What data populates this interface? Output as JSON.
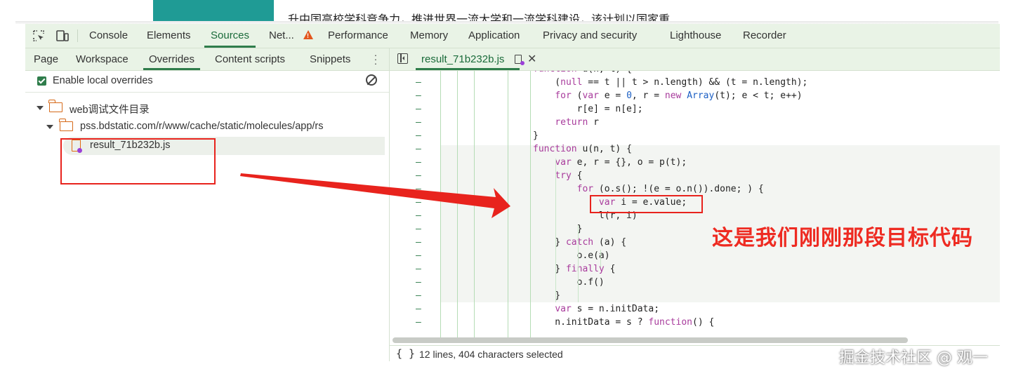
{
  "background_page": {
    "headline": "升中国高校学科竞争力，推进世界一流大学和一流学科建设，该计划以国家重"
  },
  "devtools": {
    "main_tabs": [
      {
        "label": "Console"
      },
      {
        "label": "Elements"
      },
      {
        "label": "Sources",
        "active": true
      },
      {
        "label": "Net..."
      },
      {
        "label": "Performance"
      },
      {
        "label": "Memory"
      },
      {
        "label": "Application"
      },
      {
        "label": "Privacy and security"
      },
      {
        "label": "Lighthouse"
      },
      {
        "label": "Recorder"
      }
    ],
    "left_panel": {
      "sub_tabs": [
        {
          "label": "Page"
        },
        {
          "label": "Workspace"
        },
        {
          "label": "Overrides",
          "active": true
        },
        {
          "label": "Content scripts"
        },
        {
          "label": "Snippets"
        }
      ],
      "enable_overrides_label": "Enable local overrides",
      "enable_overrides_checked": true,
      "tree": {
        "root_folder": "web调试文件目录",
        "sub_folder": "pss.bdstatic.com/r/www/cache/static/molecules/app/rs",
        "file": "result_71b232b.js"
      }
    },
    "editor": {
      "file_tab": "result_71b232b.js",
      "gutter_mark": "–",
      "lines": [
        {
          "text": "function u(n, t) {"
        },
        {
          "text": "    (null == t || t > n.length) && (t = n.length);"
        },
        {
          "text": "    for (var e = 0, r = new Array(t); e < t; e++)"
        },
        {
          "text": "        r[e] = n[e];"
        },
        {
          "text": "    return r"
        },
        {
          "text": "}"
        },
        {
          "text": "function u(n, t) {"
        },
        {
          "text": "    var e, r = {}, o = p(t);"
        },
        {
          "text": "    try {"
        },
        {
          "text": "        for (o.s(); !(e = o.n()).done; ) {"
        },
        {
          "text": "            var i = e.value;"
        },
        {
          "text": "            l(r, i)"
        },
        {
          "text": "        }"
        },
        {
          "text": "    } catch (a) {"
        },
        {
          "text": "        o.e(a)"
        },
        {
          "text": "    } finally {"
        },
        {
          "text": "        o.f()"
        },
        {
          "text": "    }"
        },
        {
          "text": "    var s = n.initData;"
        },
        {
          "text": "    n.initData = s ? function() {"
        }
      ],
      "status": "12 lines, 404 characters selected"
    }
  },
  "annotation": {
    "text": "这是我们刚刚那段目标代码",
    "color": "#ee2b22"
  },
  "watermark": "掘金技术社区 @ 观一",
  "colors": {
    "accent": "#2f7d4b",
    "toolbar_bg": "#e9f3e6",
    "keyword": "#a83b9c",
    "number": "#1c5fc4",
    "annotation_red": "#e8231d"
  }
}
